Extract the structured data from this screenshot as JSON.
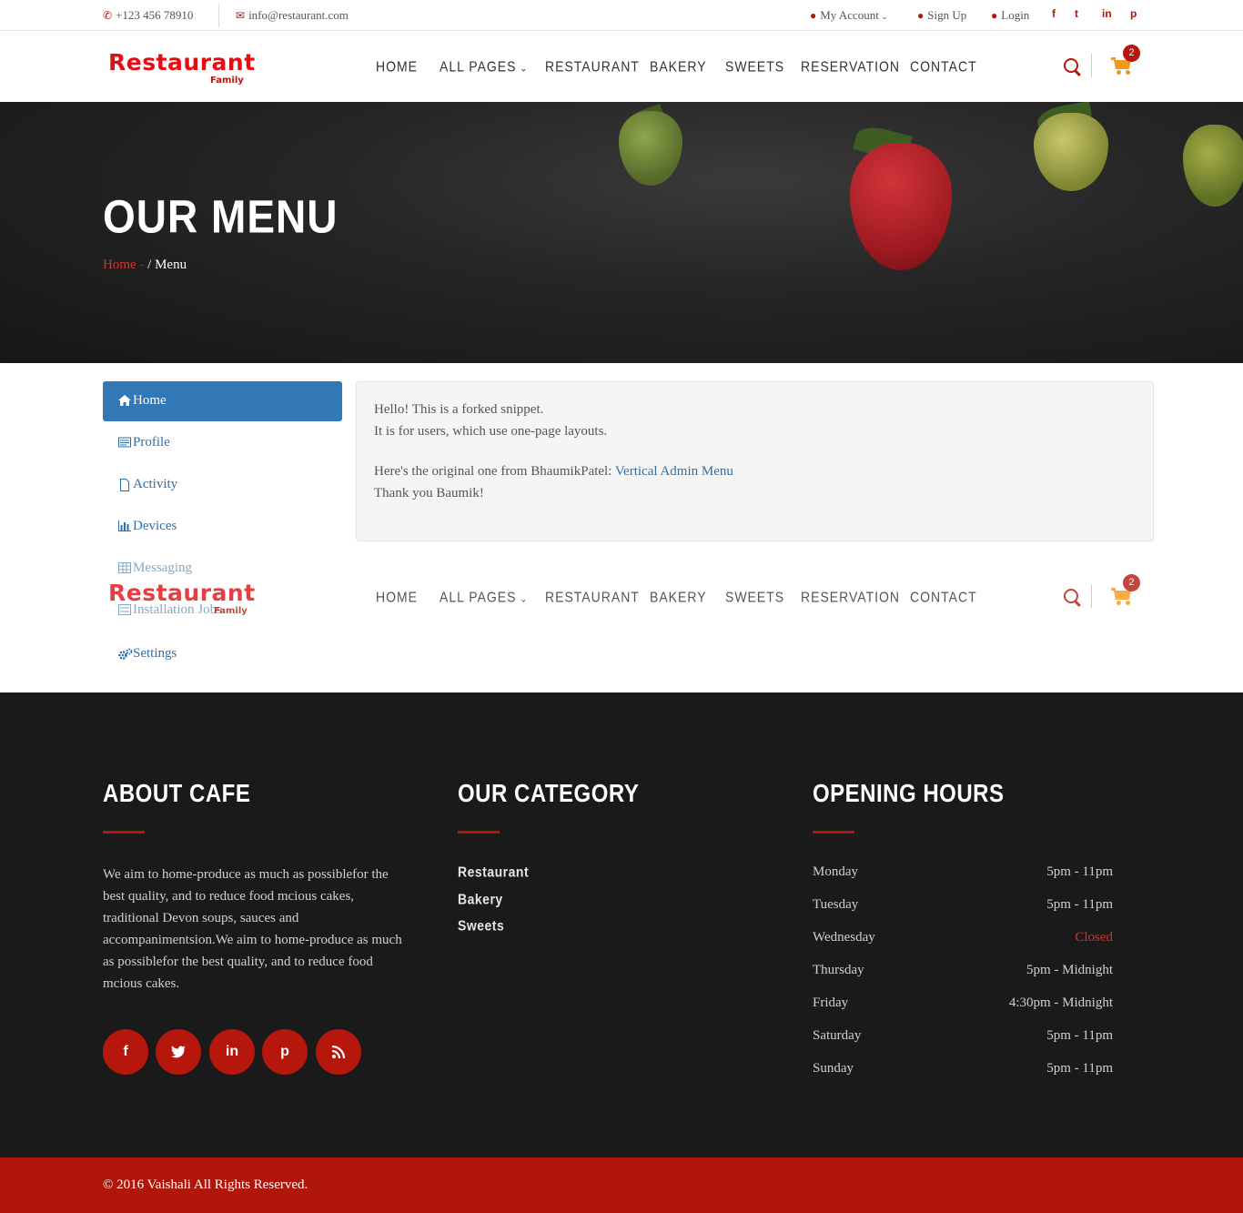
{
  "topbar": {
    "phone": "+123 456 78910",
    "email": "info@restaurant.com",
    "my_account": "My Account",
    "sign_up": "Sign Up",
    "login": "Login",
    "social": [
      "f",
      "t",
      "in",
      "p"
    ]
  },
  "logo": {
    "main": "Restaurant",
    "sub": "Family"
  },
  "nav": {
    "items": [
      "HOME",
      "ALL PAGES",
      "RESTAURANT",
      "BAKERY",
      "SWEETS",
      "RESERVATION",
      "CONTACT"
    ],
    "cart_count": "2"
  },
  "hero": {
    "title": "OUR MENU",
    "crumb_home": "Home",
    "crumb_sep": " - ",
    "crumb_current": "/ Menu"
  },
  "sidebar": {
    "items": [
      {
        "label": "Home",
        "icon": "home-icon"
      },
      {
        "label": "Profile",
        "icon": "id-card-icon"
      },
      {
        "label": "Activity",
        "icon": "file-icon"
      },
      {
        "label": "Devices",
        "icon": "bar-chart-icon"
      },
      {
        "label": "Messaging",
        "icon": "table-icon"
      },
      {
        "label": "Installation Jobs",
        "icon": "list-icon"
      },
      {
        "label": "Settings",
        "icon": "gears-icon"
      }
    ]
  },
  "content": {
    "line1": "Hello! This is a forked snippet.",
    "line2": "It is for users, which use one-page layouts.",
    "line3_prefix": "Here's the original one from BhaumikPatel: ",
    "line3_link": "Vertical Admin Menu",
    "line4": "Thank you Baumik!"
  },
  "footer": {
    "about_title": "ABOUT CAFE",
    "about_text": "We aim to home-produce as much as possiblefor the best quality, and to reduce food mcious cakes, traditional Devon soups, sauces and accompanimentsion.We aim to home-produce as much as possiblefor the best quality, and to reduce food mcious cakes.",
    "social": [
      "f",
      "t",
      "in",
      "p",
      "rss"
    ],
    "category_title": "OUR CATEGORY",
    "categories": [
      "Restaurant",
      "Bakery",
      "Sweets"
    ],
    "hours_title": "OPENING HOURS",
    "hours": [
      {
        "day": "Monday",
        "time": "5pm - 11pm"
      },
      {
        "day": "Tuesday",
        "time": "5pm - 11pm"
      },
      {
        "day": "Wednesday",
        "time": "Closed"
      },
      {
        "day": "Thursday",
        "time": "5pm - Midnight"
      },
      {
        "day": "Friday",
        "time": "4:30pm - Midnight"
      },
      {
        "day": "Saturday",
        "time": "5pm - 11pm"
      },
      {
        "day": "Sunday",
        "time": "5pm - 11pm"
      }
    ],
    "copyright": "© 2016 Vaishali All Rights Reserved."
  },
  "colors": {
    "brand_red": "#b5170c",
    "logo_red": "#e30d13",
    "link_blue": "#2f6fa8",
    "cart_orange": "#f29a16",
    "footer_bg": "#1a1a1b"
  }
}
